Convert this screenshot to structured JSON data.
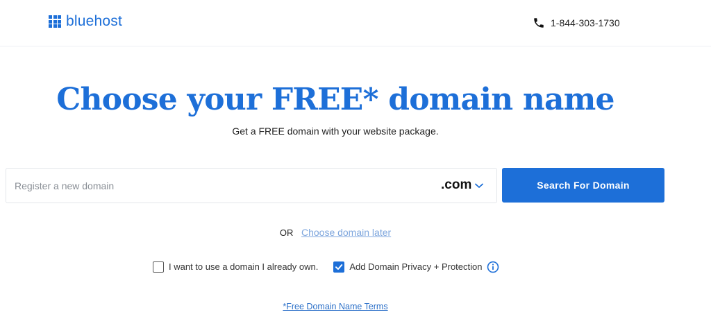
{
  "header": {
    "logo_text": "bluehost",
    "phone": "1-844-303-1730"
  },
  "hero": {
    "title": "Choose your FREE* domain name",
    "subtitle": "Get a FREE domain with your website package."
  },
  "search": {
    "placeholder": "Register a new domain",
    "value": "",
    "tld": ".com",
    "button_label": "Search For Domain"
  },
  "alternative": {
    "or_text": "OR",
    "link_text": "Choose domain later"
  },
  "options": {
    "own_domain_label": "I want to use a domain I already own.",
    "own_domain_checked": false,
    "privacy_label": "Add Domain Privacy + Protection",
    "privacy_checked": true
  },
  "footer": {
    "terms_text": "*Free Domain Name Terms"
  },
  "colors": {
    "brand": "#1d6fd8",
    "link_muted": "#7ea6dd"
  }
}
